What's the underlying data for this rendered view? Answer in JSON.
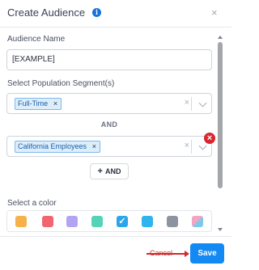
{
  "header": {
    "title": "Create Audience",
    "info_icon": "info-icon",
    "close_icon": "close-icon",
    "close_glyph": "×"
  },
  "audience_name": {
    "label": "Audience Name",
    "value": "[EXAMPLE]"
  },
  "segments": {
    "label": "Select Population Segment(s)",
    "groups": [
      {
        "chips": [
          "Full-Time"
        ],
        "removable": false
      },
      {
        "chips": [
          "California Employees"
        ],
        "removable": true
      }
    ],
    "and_separator": "AND",
    "chip_remove_glyph": "×",
    "clear_glyph": "×",
    "remove_glyph": "×"
  },
  "add_and_button": {
    "label": "AND",
    "plus": "+"
  },
  "color_picker": {
    "label": "Select a color",
    "check_glyph": "✓",
    "swatches": [
      {
        "color": "#f7b14a",
        "selected": false
      },
      {
        "color": "#f0656f",
        "selected": false
      },
      {
        "color": "#b3a4f2",
        "selected": false
      },
      {
        "color": "#56d3b6",
        "selected": false
      },
      {
        "color": "#2aa6ea",
        "selected": true
      },
      {
        "color": "#2fb4ee",
        "selected": false
      },
      {
        "color": "#8d949f",
        "selected": false
      },
      {
        "color": "multicolor",
        "selected": false
      }
    ]
  },
  "footer": {
    "cancel_label": "Cancel",
    "save_label": "Save"
  },
  "colors": {
    "primary": "#1289f3",
    "danger": "#d9272e",
    "chip_bg": "#ddeefb"
  }
}
